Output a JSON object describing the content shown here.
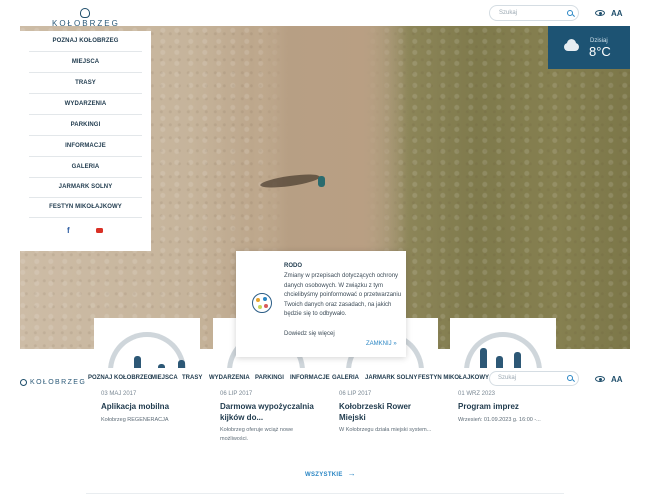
{
  "header": {
    "logo_text": "KOŁOBRZEG",
    "search_placeholder": "Szukaj",
    "font_size_label": "AA"
  },
  "weather": {
    "label": "Dzisiaj",
    "temperature": "8°C"
  },
  "sidebar": {
    "items": [
      {
        "label": "POZNAJ KOŁOBRZEG"
      },
      {
        "label": "MIEJSCA"
      },
      {
        "label": "TRASY"
      },
      {
        "label": "WYDARZENIA"
      },
      {
        "label": "PARKINGI"
      },
      {
        "label": "INFORMACJE"
      },
      {
        "label": "GALERIA"
      },
      {
        "label": "JARMARK SOLNY"
      },
      {
        "label": "FESTYN MIKOŁAJKOWY"
      }
    ],
    "facebook": "f"
  },
  "navbar": {
    "logo_text": "KOŁOBRZEG",
    "items": [
      {
        "label": "POZNAJ KOŁOBRZEG"
      },
      {
        "label": "MIEJSCA"
      },
      {
        "label": "TRASY"
      },
      {
        "label": "WYDARZENIA"
      },
      {
        "label": "PARKINGI"
      },
      {
        "label": "INFORMACJE"
      },
      {
        "label": "GALERIA"
      },
      {
        "label": "JARMARK SOLNY"
      },
      {
        "label": "FESTYN MIKOŁAJKOWY"
      }
    ],
    "search_placeholder": "Szukaj",
    "font_size_label": "AA"
  },
  "news": [
    {
      "date": "03 MAJ 2017",
      "title": "Aplikacja mobilna",
      "desc": "Kołobrzeg REGENERACJA"
    },
    {
      "date": "06 LIP 2017",
      "title": "Darmowa wypożyczalnia kijków do...",
      "desc": "Kołobrzeg oferuje wciąż nowe możliwości."
    },
    {
      "date": "06 LIP 2017",
      "title": "Kołobrzeski Rower Miejski",
      "desc": "W Kołobrzegu działa miejski system..."
    },
    {
      "date": "01 WRZ 2023",
      "title": "Program imprez",
      "desc": "Wrzesień: 01.09.2023 g. 16:00 -..."
    }
  ],
  "all_link": "WSZYSTKIE",
  "rodo": {
    "title": "RODO",
    "text": "Zmiany w przepisach dotyczących ochrony danych osobowych. W związku z tym chcielibyśmy poinformować o przetwarzaniu Twoich danych oraz zasadach, na jakich będzie się to odbywało.",
    "more": "Dowiedz się więcej",
    "close": "ZAMKNIJ »"
  }
}
